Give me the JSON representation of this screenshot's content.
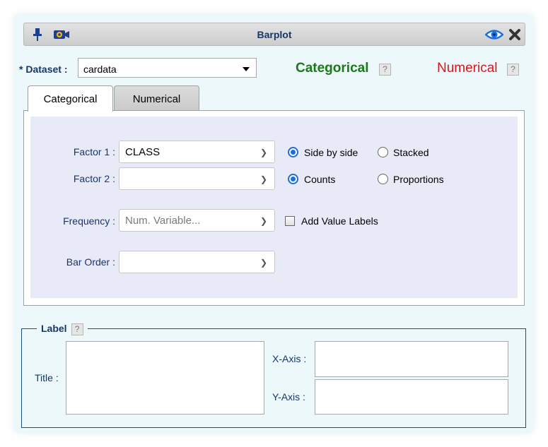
{
  "window": {
    "title": "Barplot"
  },
  "dataset": {
    "label": "Dataset :",
    "required_mark": "*",
    "value": "cardata"
  },
  "type_links": {
    "categorical": "Categorical",
    "numerical": "Numerical",
    "help": "?"
  },
  "tabs": [
    {
      "label": "Categorical",
      "active": true
    },
    {
      "label": "Numerical",
      "active": false
    }
  ],
  "form": {
    "factor1": {
      "label": "Factor 1 :",
      "value": "CLASS"
    },
    "factor2": {
      "label": "Factor 2 :",
      "value": ""
    },
    "frequency": {
      "label": "Frequency :",
      "placeholder": "Num. Variable..."
    },
    "bar_order": {
      "label": "Bar Order :",
      "value": ""
    },
    "layout": {
      "side_by_side": "Side by side",
      "stacked": "Stacked",
      "selected": "side_by_side"
    },
    "measure": {
      "counts": "Counts",
      "proportions": "Proportions",
      "selected": "counts"
    },
    "value_labels": {
      "label": "Add Value Labels",
      "checked": false
    }
  },
  "label_section": {
    "legend": "Label",
    "help": "?",
    "title_label": "Title :",
    "xaxis_label": "X-Axis :",
    "yaxis_label": "Y-Axis :"
  },
  "colors": {
    "categorical": "#1a7a1a",
    "numerical": "#d9181e",
    "accent": "#1a6fe0",
    "label_text": "#17366a"
  }
}
